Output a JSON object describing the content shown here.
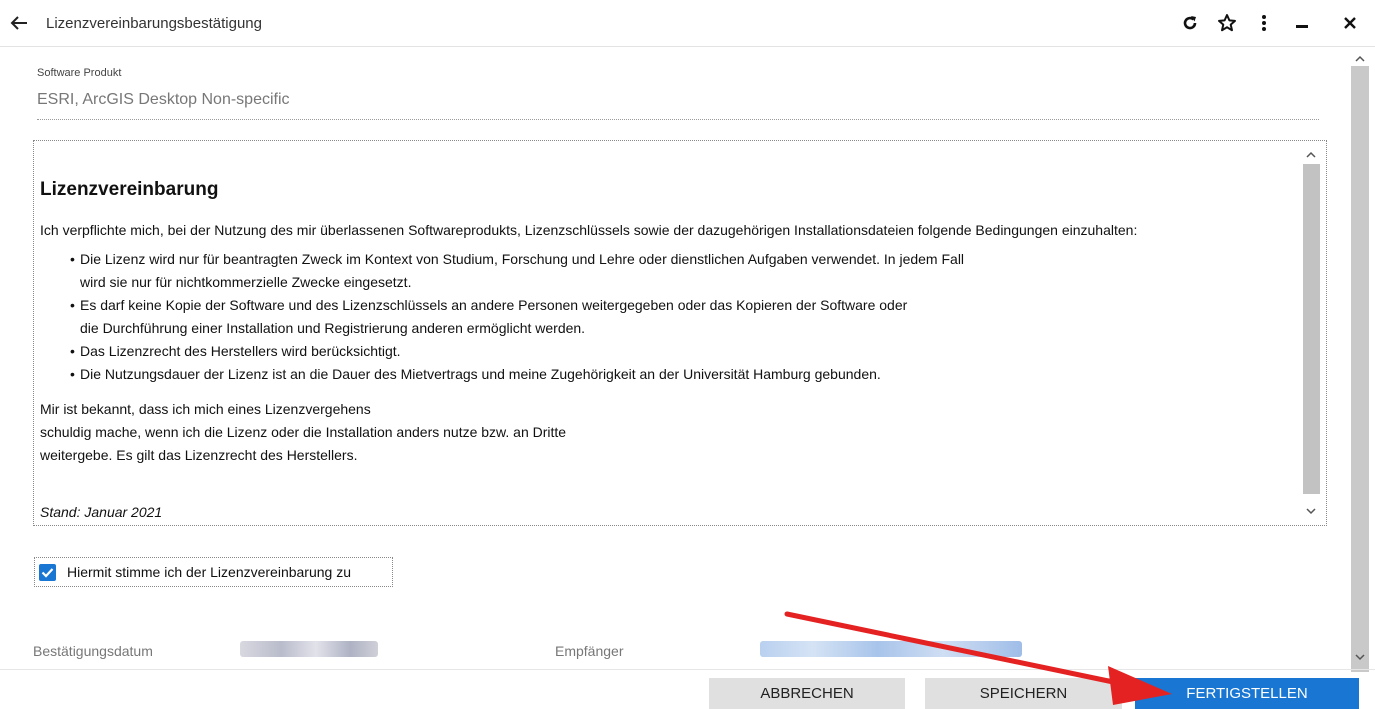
{
  "header": {
    "title": "Lizenzvereinbarungsbestätigung",
    "icons": [
      "back-arrow-icon",
      "reload-icon",
      "star-icon",
      "more-vert-icon",
      "minimize-icon",
      "close-icon"
    ]
  },
  "software": {
    "label": "Software Produkt",
    "value": "ESRI, ArcGIS Desktop Non-specific"
  },
  "license": {
    "title": "Lizenzvereinbarung",
    "intro": "Ich verpflichte mich, bei der Nutzung des mir überlassenen Softwareprodukts, Lizenzschlüssels sowie der dazugehörigen Installationsdateien folgende Bedingungen einzuhalten:",
    "items": [
      {
        "line1": "Die Lizenz wird nur für beantragten Zweck im Kontext von Studium, Forschung und Lehre oder dienstlichen Aufgaben verwendet. In jedem Fall",
        "line2": "wird sie nur für nichtkommerzielle Zwecke eingesetzt."
      },
      {
        "line1": "Es darf keine Kopie der Software und des Lizenzschlüssels an andere Personen weitergegeben oder das Kopieren der Software oder",
        "line2": "die Durchführung einer Installation und Registrierung anderen ermöglicht werden."
      },
      {
        "line1": "Das Lizenzrecht des Herstellers wird berücksichtigt.",
        "line2": ""
      },
      {
        "line1": "Die Nutzungsdauer der Lizenz ist an die Dauer des Mietvertrags und meine Zugehörigkeit an der Universität Hamburg gebunden.",
        "line2": ""
      }
    ],
    "paragraph": [
      "Mir ist bekannt, dass ich mich eines Lizenzvergehens",
      "schuldig mache, wenn ich die Lizenz oder die Installation anders nutze bzw. an Dritte",
      "weitergebe. Es gilt das Lizenzrecht des Herstellers."
    ],
    "stand": "Stand: Januar 2021"
  },
  "agreement": {
    "checked": true,
    "label": "Hiermit stimme ich der Lizenzvereinbarung zu"
  },
  "meta": {
    "date_label": "Bestätigungsdatum",
    "recipient_label": "Empfänger"
  },
  "buttons": {
    "cancel": "ABBRECHEN",
    "save": "SPEICHERN",
    "finish": "FERTIGSTELLEN"
  },
  "colors": {
    "primary": "#1976d2",
    "annotation_arrow": "#e52222"
  }
}
